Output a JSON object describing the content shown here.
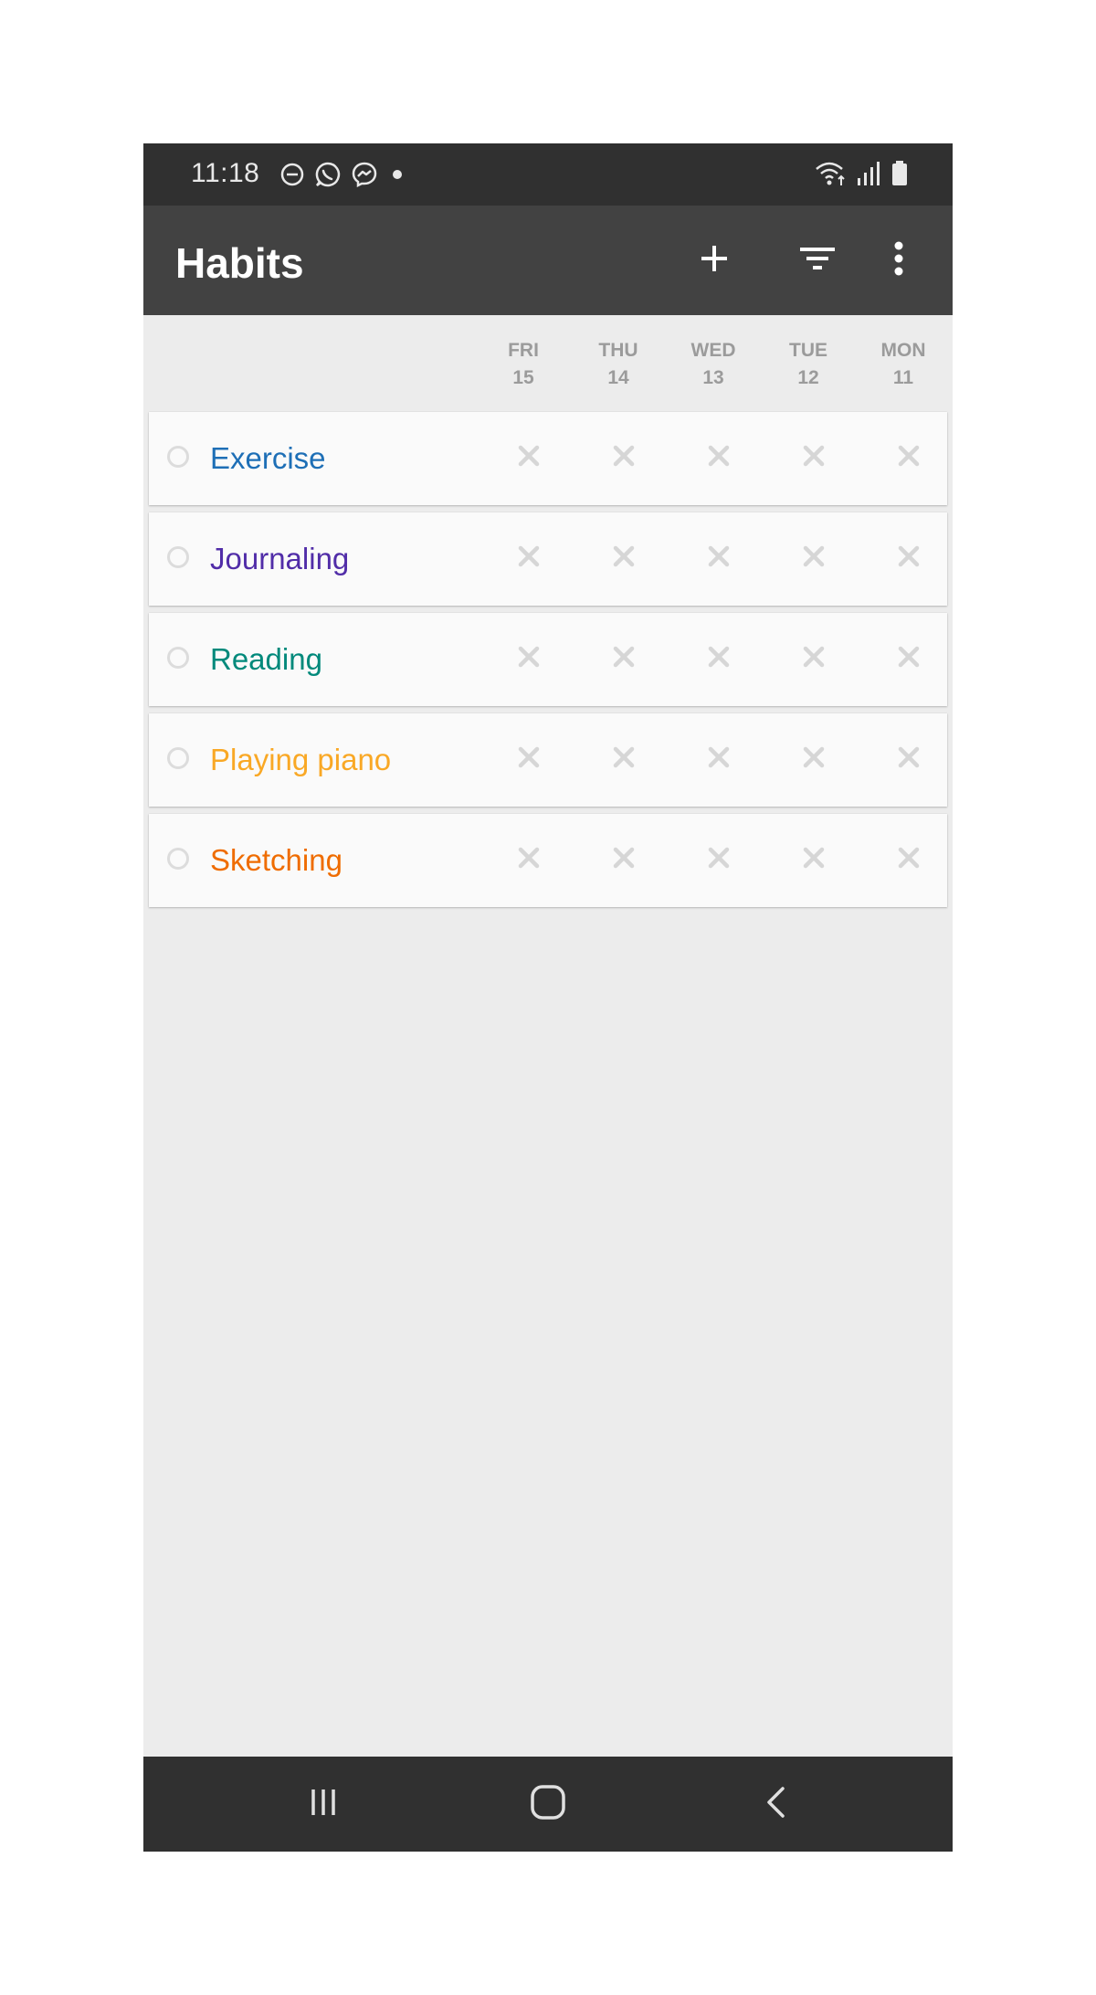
{
  "status_bar": {
    "time": "11:18",
    "left_icons": [
      "do-not-disturb-icon",
      "whatsapp-icon",
      "messenger-icon",
      "notification-dot-icon"
    ],
    "right_icons": [
      "wifi-icon",
      "cell-signal-icon",
      "battery-icon"
    ]
  },
  "app_bar": {
    "title": "Habits",
    "actions": [
      "add-icon",
      "filter-icon",
      "more-vert-icon"
    ],
    "background": "#424242"
  },
  "day_columns": [
    {
      "day": "FRI",
      "date": "15"
    },
    {
      "day": "THU",
      "date": "14"
    },
    {
      "day": "WED",
      "date": "13"
    },
    {
      "day": "TUE",
      "date": "12"
    },
    {
      "day": "MON",
      "date": "11"
    }
  ],
  "habits": [
    {
      "name": "Exercise",
      "color": "#1e6fb6",
      "checks": [
        false,
        false,
        false,
        false,
        false
      ]
    },
    {
      "name": "Journaling",
      "color": "#512da8",
      "checks": [
        false,
        false,
        false,
        false,
        false
      ]
    },
    {
      "name": "Reading",
      "color": "#00897b",
      "checks": [
        false,
        false,
        false,
        false,
        false
      ]
    },
    {
      "name": "Playing piano",
      "color": "#f9a825",
      "checks": [
        false,
        false,
        false,
        false,
        false
      ]
    },
    {
      "name": "Sketching",
      "color": "#ef6c00",
      "checks": [
        false,
        false,
        false,
        false,
        false
      ]
    }
  ],
  "nav_bar": {
    "buttons": [
      "recent-apps-icon",
      "home-icon",
      "back-icon"
    ]
  }
}
